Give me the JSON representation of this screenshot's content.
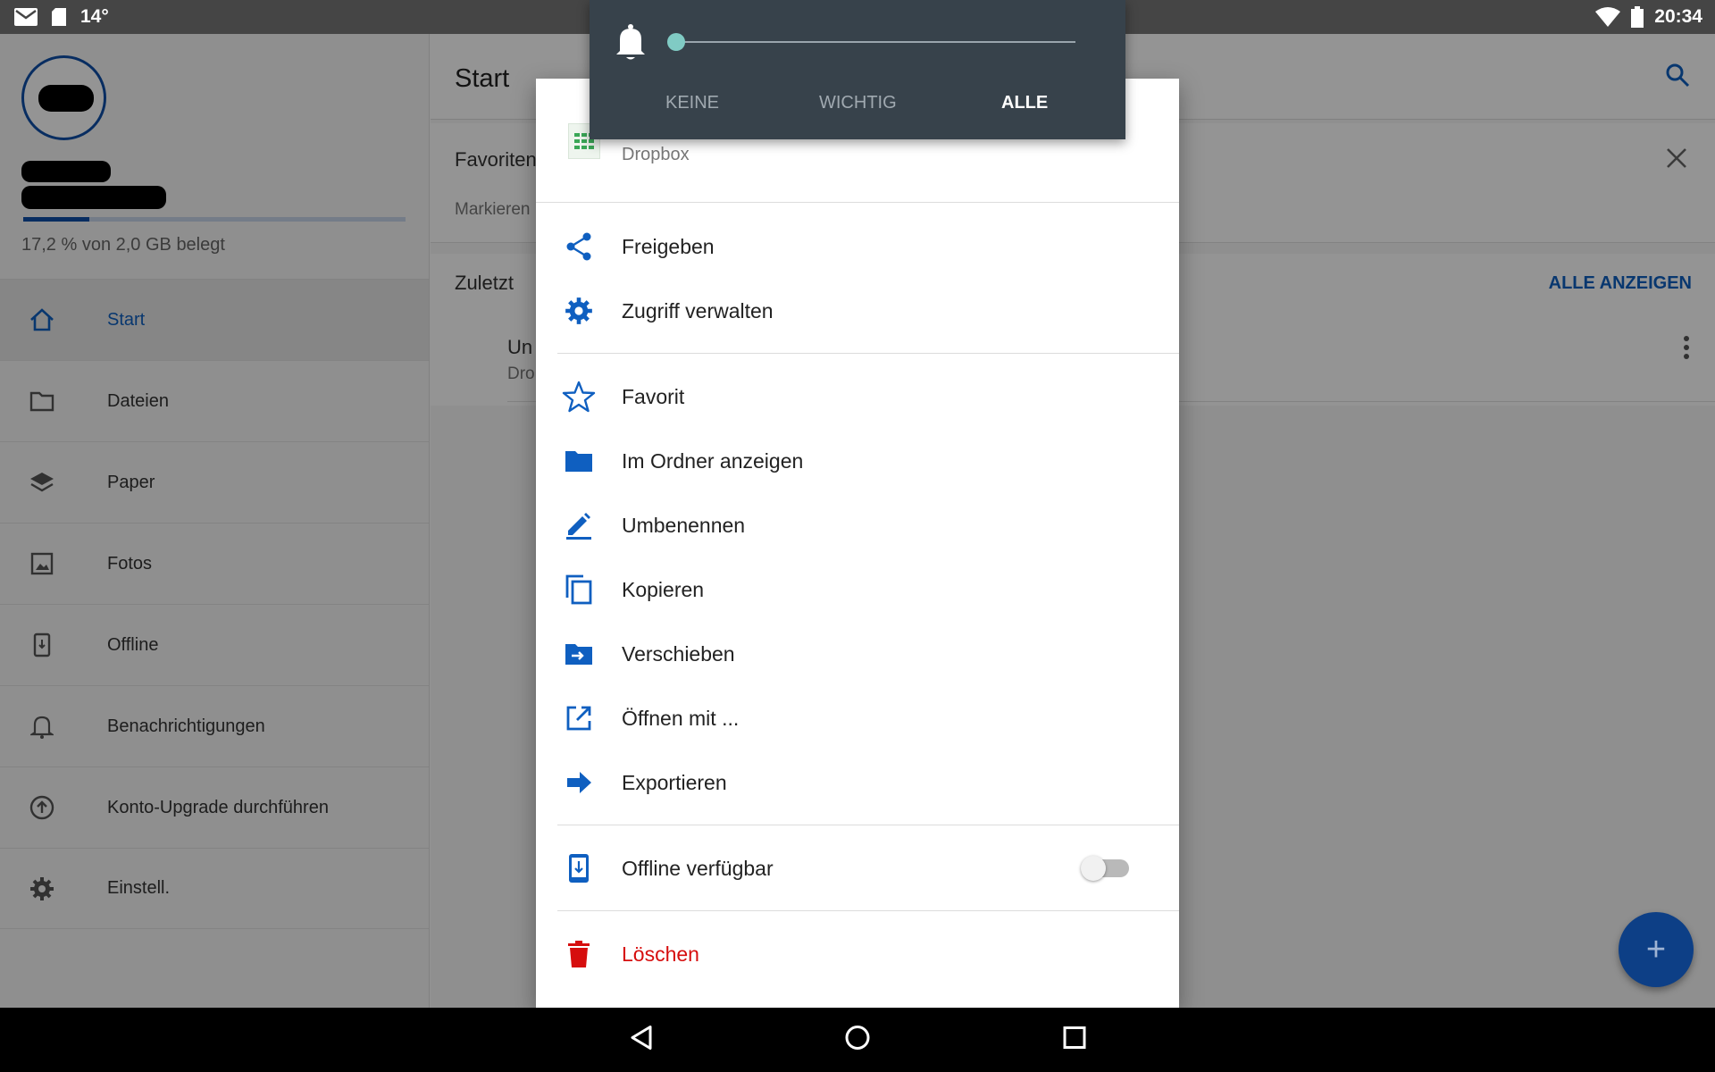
{
  "status_bar": {
    "temperature": "14°",
    "time": "20:34",
    "left_icons": [
      "mail-icon",
      "sd-card-icon"
    ],
    "right_icons": [
      "wifi-icon",
      "battery-icon"
    ]
  },
  "sidebar": {
    "quota_fraction": 0.172,
    "quota_text": "17,2 % von 2,0 GB belegt",
    "items": [
      {
        "label": "Start",
        "icon": "home-icon",
        "active": true
      },
      {
        "label": "Dateien",
        "icon": "folder-icon"
      },
      {
        "label": "Paper",
        "icon": "layers-icon"
      },
      {
        "label": "Fotos",
        "icon": "photo-icon"
      },
      {
        "label": "Offline",
        "icon": "offline-phone-icon"
      },
      {
        "label": "Benachrichtigungen",
        "icon": "bell-icon"
      },
      {
        "label": "Konto-Upgrade durchführen",
        "icon": "upgrade-icon"
      },
      {
        "label": "Einstell.",
        "icon": "gear-icon"
      }
    ]
  },
  "main": {
    "title": "Start",
    "favorites_title": "Favoriten",
    "favorites_sub": "Markieren",
    "recent_title": "Zuletzt",
    "show_all_label": "ALLE ANZEIGEN",
    "recent_file_name": "Un",
    "recent_file_sub": "Dro"
  },
  "dialog": {
    "file_location": "Dropbox",
    "items": [
      {
        "label": "Freigeben",
        "icon": "share-icon"
      },
      {
        "label": "Zugriff verwalten",
        "icon": "gear-icon"
      },
      {
        "label": "Favorit",
        "icon": "star-icon"
      },
      {
        "label": "Im Ordner anzeigen",
        "icon": "folder-icon"
      },
      {
        "label": "Umbenennen",
        "icon": "pencil-icon"
      },
      {
        "label": "Kopieren",
        "icon": "copy-icon"
      },
      {
        "label": "Verschieben",
        "icon": "move-folder-icon"
      },
      {
        "label": "Öffnen mit ...",
        "icon": "open-external-icon"
      },
      {
        "label": "Exportieren",
        "icon": "export-arrow-icon"
      },
      {
        "label": "Offline verfügbar",
        "icon": "offline-phone-icon",
        "toggle": false
      },
      {
        "label": "Löschen",
        "icon": "trash-icon",
        "danger": true
      }
    ]
  },
  "notification_popup": {
    "options": [
      "KEINE",
      "WICHTIG",
      "ALLE"
    ],
    "selected": "ALLE",
    "level": 0
  },
  "colors": {
    "accent": "#0f5fc0",
    "danger": "#d60e0e",
    "popup_bg": "#37424b",
    "slider_thumb": "#80cbc4"
  }
}
